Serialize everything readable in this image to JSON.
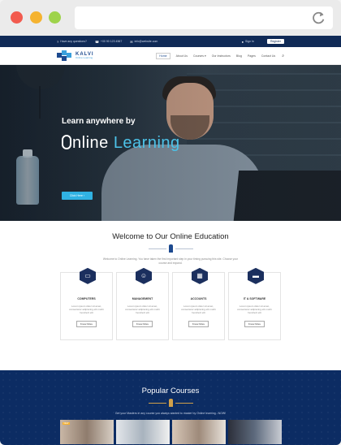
{
  "browser": {
    "url": ""
  },
  "topbar": {
    "question": "Have any questions?",
    "phone": "+00 90 123 4567",
    "email": "info@website.com",
    "signin": "Sign In",
    "register": "Register"
  },
  "nav": {
    "logo_name": "KALVI",
    "logo_tagline": "Online Learning",
    "items": [
      "Home",
      "About Us",
      "Courses",
      "Our Instructors",
      "Blog",
      "Pages",
      "Contact Us"
    ]
  },
  "hero": {
    "subtitle": "Learn anywhere by",
    "title_part1": "nline ",
    "title_part2": "Learning",
    "button": "Click Here"
  },
  "welcome": {
    "title": "Welcome to Our Online Education",
    "description": "Welcome to Online Learning. You have taken the first important step in your timing pursuing this site. Choose your course and expand."
  },
  "cards": [
    {
      "icon": "monitor-icon",
      "title": "COMPUTERS",
      "text": "Lorem ipsum dolor sit amet, consectetur adipiscing elit morbi hendrerit elit",
      "button": "Know More"
    },
    {
      "icon": "user-icon",
      "title": "MANAGEMENT",
      "text": "Lorem ipsum dolor sit amet, consectetur adipiscing elit morbi hendrerit elit",
      "button": "Know More"
    },
    {
      "icon": "calculator-icon",
      "title": "ACCOUNTS",
      "text": "Lorem ipsum dolor sit amet, consectetur adipiscing elit morbi hendrerit elit",
      "button": "Know More"
    },
    {
      "icon": "laptop-icon",
      "title": "IT & SOFTWARE",
      "text": "Lorem ipsum dolor sit amet, consectetur adipiscing elit morbi hendrerit elit",
      "button": "Know More"
    }
  ],
  "popular": {
    "title": "Popular Courses",
    "description": "Get your Masters in any course you always wanted to master by Online learning...NOW!",
    "badges": [
      "NEW",
      "",
      "",
      ""
    ]
  },
  "colors": {
    "navy": "#102a56",
    "accent_blue": "#30b2e3",
    "gold": "#d0a04a"
  }
}
